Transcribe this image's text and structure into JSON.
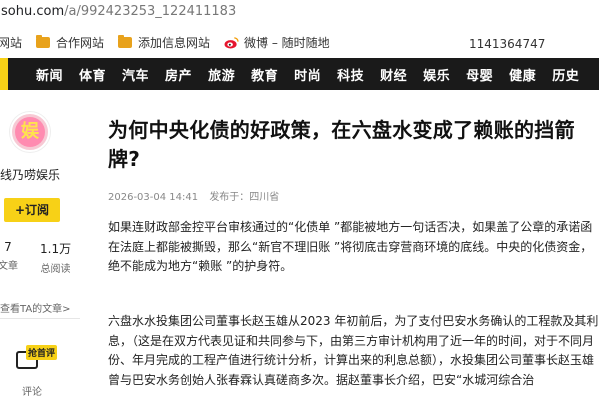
{
  "address_bar": {
    "host": "sohu.com",
    "path": "/a/992423253_122411183"
  },
  "bookmarks": {
    "items": [
      "网站",
      "合作网站",
      "添加信息网站",
      "微博 – 随时随地"
    ],
    "number": "1141364747"
  },
  "nav": {
    "items": [
      "新闻",
      "体育",
      "汽车",
      "房产",
      "旅游",
      "教育",
      "时尚",
      "科技",
      "财经",
      "娱乐",
      "母婴",
      "健康",
      "历史"
    ],
    "accent": "#f7d117"
  },
  "author": {
    "avatar_glyph": "娱",
    "name": "线乃唠娱乐",
    "subscribe": "+订阅",
    "stats": [
      {
        "value": "7",
        "label": "文章"
      },
      {
        "value": "1.1万",
        "label": "总阅读"
      }
    ],
    "more": "查看TA的文章>",
    "hot_comment_tag": "抢首评",
    "comment_label": "评论"
  },
  "article": {
    "title": "为何中央化债的好政策，在六盘水变成了赖账的挡箭牌?",
    "date": "2026-03-04 14:41",
    "source": "发布于：四川省",
    "paragraphs": [
      "如果连财政部金控平台审核通过的“化债单 ”都能被地方一句话否决，如果盖了公章的承诺函在法庭上都能被撕毁，那么“新官不理旧账 ”将彻底击穿营商环境的底线。中央的化债资金，绝不能成为地方“赖账 ”的护身符。",
      "六盘水水投集团公司董事长赵玉雄从2023 年初前后，为了支付巴安水务确认的工程款及其利息，（这是在双方代表见证和共同参与下，由第三方审计机构用了近一年的时间，对于不同月份、年月完成的工程产值进行统计分析，计算出来的利息总额），水投集团公司董事长赵玉雄曾与巴安水务创始人张春霖认真磋商多次。据赵董事长介绍，巴安“水城河综合治"
    ]
  }
}
